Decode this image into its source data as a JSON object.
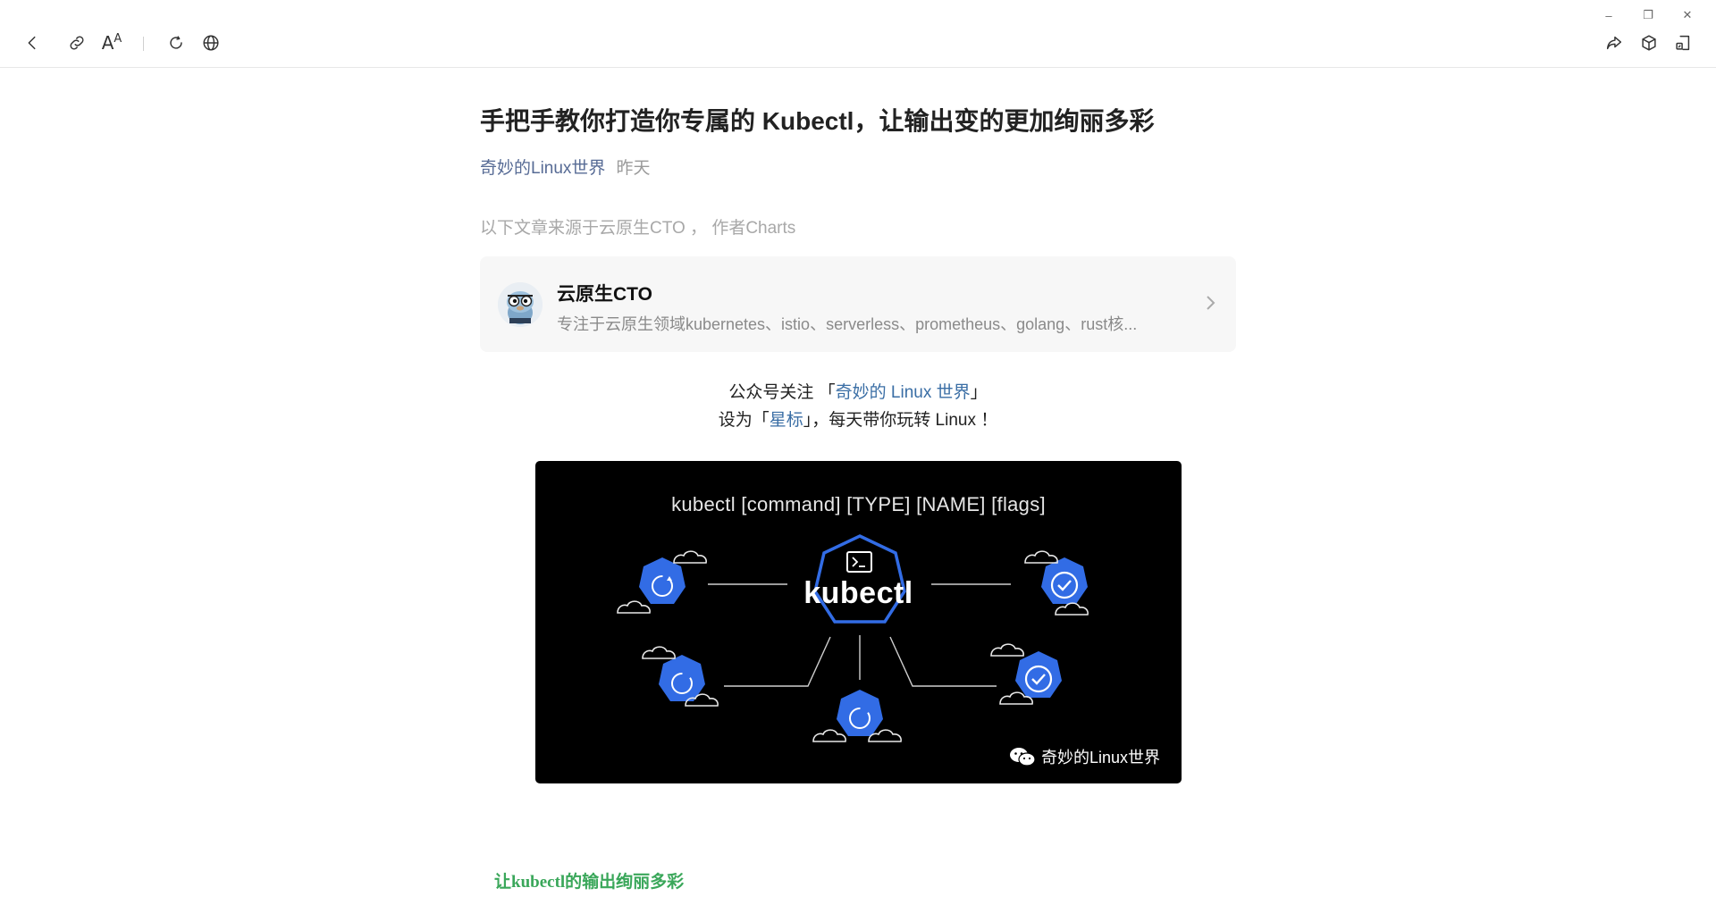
{
  "window": {
    "minimize_label": "–",
    "restore_label": "❐",
    "close_label": "✕"
  },
  "toolbar": {
    "font_label": "A",
    "font_label_small": "A"
  },
  "article": {
    "title": "手把手教你打造你专属的 Kubectl，让输出变的更加绚丽多彩",
    "account": "奇妙的Linux世界",
    "date": "昨天",
    "source": "以下文章来源于云原生CTO ，  作者Charts"
  },
  "card": {
    "name": "云原生CTO",
    "description": "专注于云原生领域kubernetes、istio、serverless、prometheus、golang、rust核..."
  },
  "follow": {
    "line1_prefix": "公众号关注 「",
    "line1_link": "奇妙的 Linux 世界",
    "line1_suffix": "」",
    "line2_prefix": "设为「",
    "line2_link": "星标",
    "line2_suffix": "」，每天带你玩转 Linux ！"
  },
  "banner": {
    "command": "kubectl [command] [TYPE] [NAME] [flags]",
    "logo_text": "kubectl",
    "watermark": "奇妙的Linux世界"
  },
  "section": {
    "heading": "让kubectl的输出绚丽多彩"
  },
  "colors": {
    "account_link": "#576b95",
    "follow_link": "#3a6ea5",
    "heading_green": "#3aa75a",
    "k8s_blue": "#326ce5"
  }
}
